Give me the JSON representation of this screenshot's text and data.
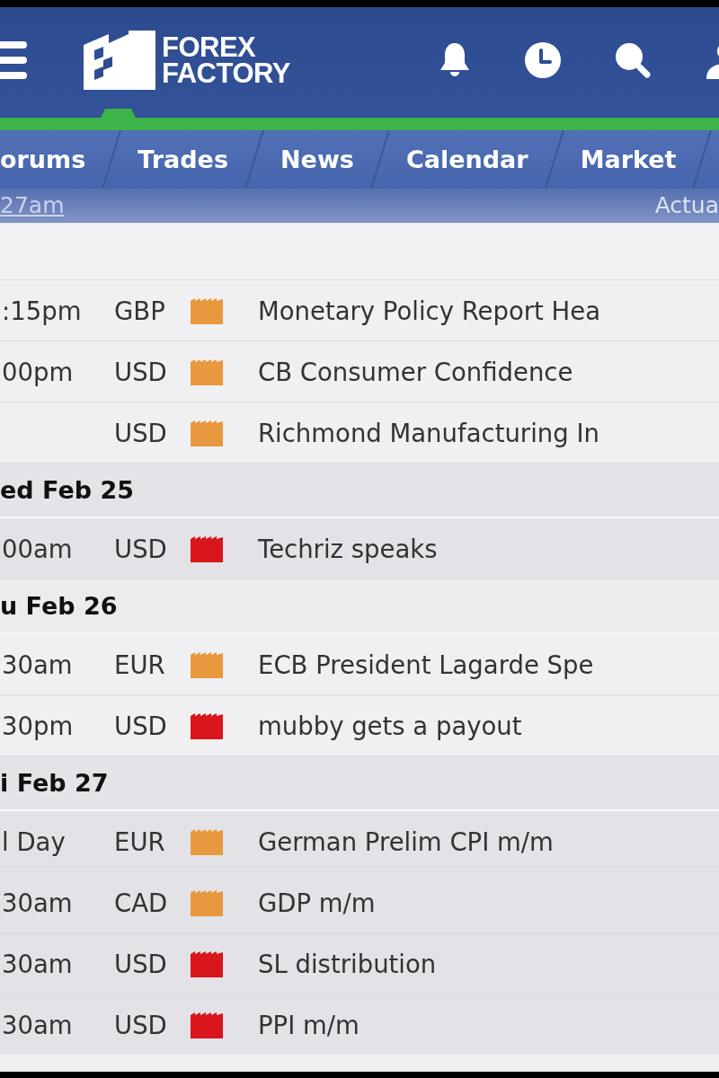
{
  "header": {
    "logo_lines": [
      "FOREX",
      "FACTORY"
    ]
  },
  "nav_tabs": [
    "orums",
    "Trades",
    "News",
    "Calendar",
    "Market"
  ],
  "sub_bar": {
    "time_link": "27am",
    "column_label": "Actua"
  },
  "calendar": {
    "days": [
      {
        "events": [
          {
            "time": ":15pm",
            "currency": "GBP",
            "color": "#e8993d",
            "title": "Monetary Policy Report Hea"
          },
          {
            "time": "00pm",
            "currency": "USD",
            "color": "#e8993d",
            "title": "CB Consumer Confidence"
          },
          {
            "currency": "USD",
            "color": "#e8993d",
            "title": "Richmond Manufacturing In"
          }
        ]
      },
      {
        "date": "ed Feb 25",
        "events": [
          {
            "time": "00am",
            "currency": "USD",
            "color": "#d8161c",
            "title": "Techriz speaks"
          }
        ]
      },
      {
        "date": "u Feb 26",
        "events": [
          {
            "time": "30am",
            "currency": "EUR",
            "color": "#e8993d",
            "title": "ECB President Lagarde Spe"
          },
          {
            "time": "30pm",
            "currency": "USD",
            "color": "#d8161c",
            "title": "mubby gets a payout"
          }
        ]
      },
      {
        "date": "i Feb 27",
        "events": [
          {
            "time": "l Day",
            "currency": "EUR",
            "color": "#e8993d",
            "title": "German Prelim CPI m/m"
          },
          {
            "time": "30am",
            "currency": "CAD",
            "color": "#e8993d",
            "title": "GDP m/m"
          },
          {
            "time": "30am",
            "currency": "USD",
            "color": "#d8161c",
            "title": "SL distribution"
          },
          {
            "time": "30am",
            "currency": "USD",
            "color": "#d8161c",
            "title": "PPI m/m"
          }
        ]
      }
    ]
  }
}
